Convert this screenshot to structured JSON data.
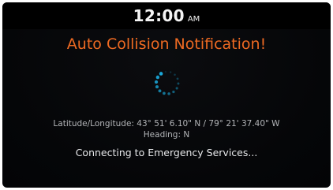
{
  "status_bar": {
    "time": "12:00",
    "ampm": "AM"
  },
  "alert": {
    "title": "Auto Collision Notification!",
    "coordinates_text": "Latitude/Longitude:  43°  51'  6.10\" N  / 79°  21'  37.40\" W",
    "heading_text": "Heading: N",
    "status_text": "Connecting to Emergency Services..."
  },
  "spinner": {
    "icon": "loading-spinner-icon",
    "color": "#1aa7d8",
    "dot_count": 14
  },
  "colors": {
    "background": "#050608",
    "title": "#ee6a22",
    "secondary_text": "#b3b5b8",
    "primary_text": "#e6e7e9"
  }
}
